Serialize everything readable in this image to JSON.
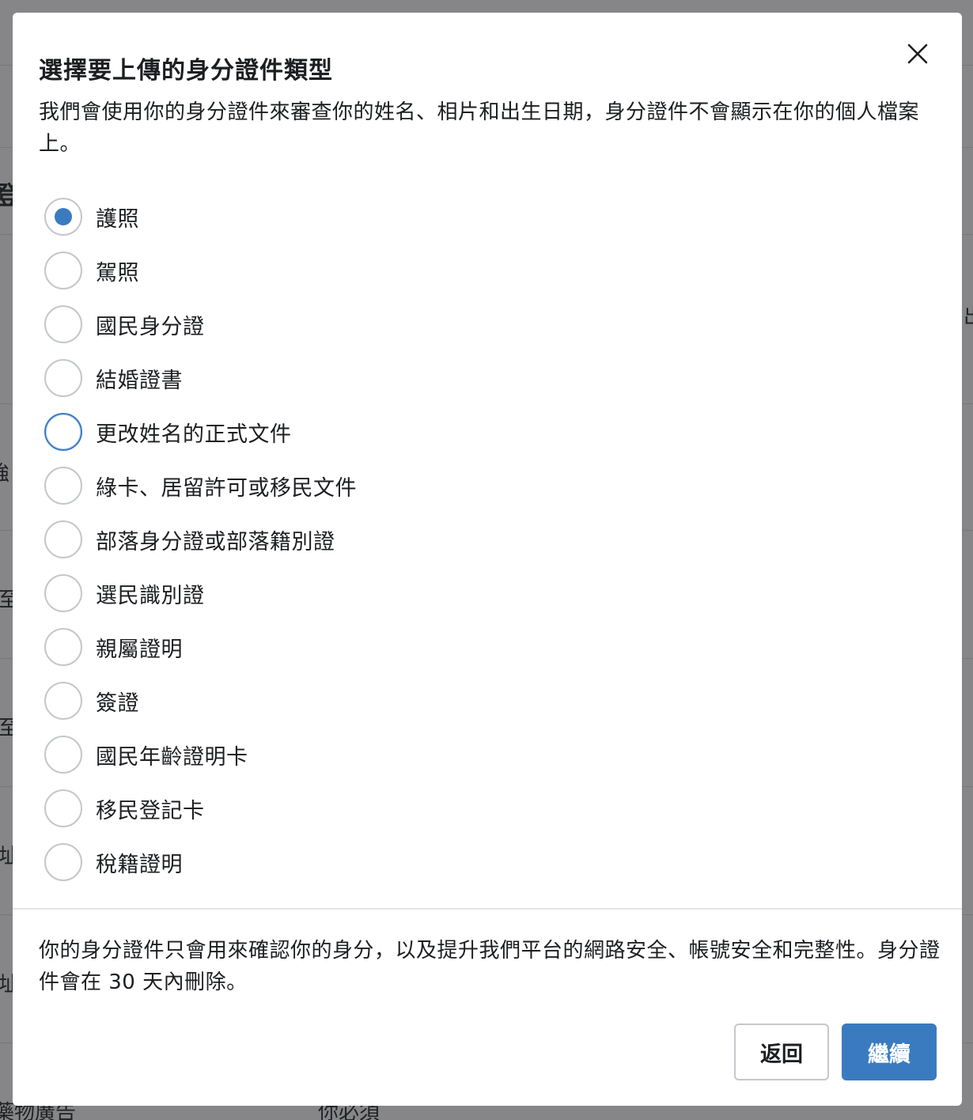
{
  "background": {
    "fragments": [
      "登",
      "出",
      "強",
      "望至",
      "望至",
      "地址",
      "地址",
      "藥物廣告",
      "你必須"
    ]
  },
  "modal": {
    "title": "選擇要上傳的身分證件類型",
    "description": "我們會使用你的身分證件來審查你的姓名、相片和出生日期，身分證件不會顯示在你的個人檔案上。",
    "options": [
      {
        "label": "護照",
        "selected": true
      },
      {
        "label": "駕照",
        "selected": false
      },
      {
        "label": "國民身分證",
        "selected": false
      },
      {
        "label": "結婚證書",
        "selected": false
      },
      {
        "label": "更改姓名的正式文件",
        "selected": false,
        "focused": true
      },
      {
        "label": "綠卡、居留許可或移民文件",
        "selected": false
      },
      {
        "label": "部落身分證或部落籍別證",
        "selected": false
      },
      {
        "label": "選民識別證",
        "selected": false
      },
      {
        "label": "親屬證明",
        "selected": false
      },
      {
        "label": "簽證",
        "selected": false
      },
      {
        "label": "國民年齡證明卡",
        "selected": false
      },
      {
        "label": "移民登記卡",
        "selected": false
      },
      {
        "label": "稅籍證明",
        "selected": false
      }
    ],
    "footer_note": "你的身分證件只會用來確認你的身分，以及提升我們平台的網路安全、帳號安全和完整性。身分證件會在 30 天內刪除。",
    "back_label": "返回",
    "continue_label": "繼續"
  },
  "colors": {
    "accent": "#3a7bc0",
    "overlay": "#8c8c8c"
  }
}
